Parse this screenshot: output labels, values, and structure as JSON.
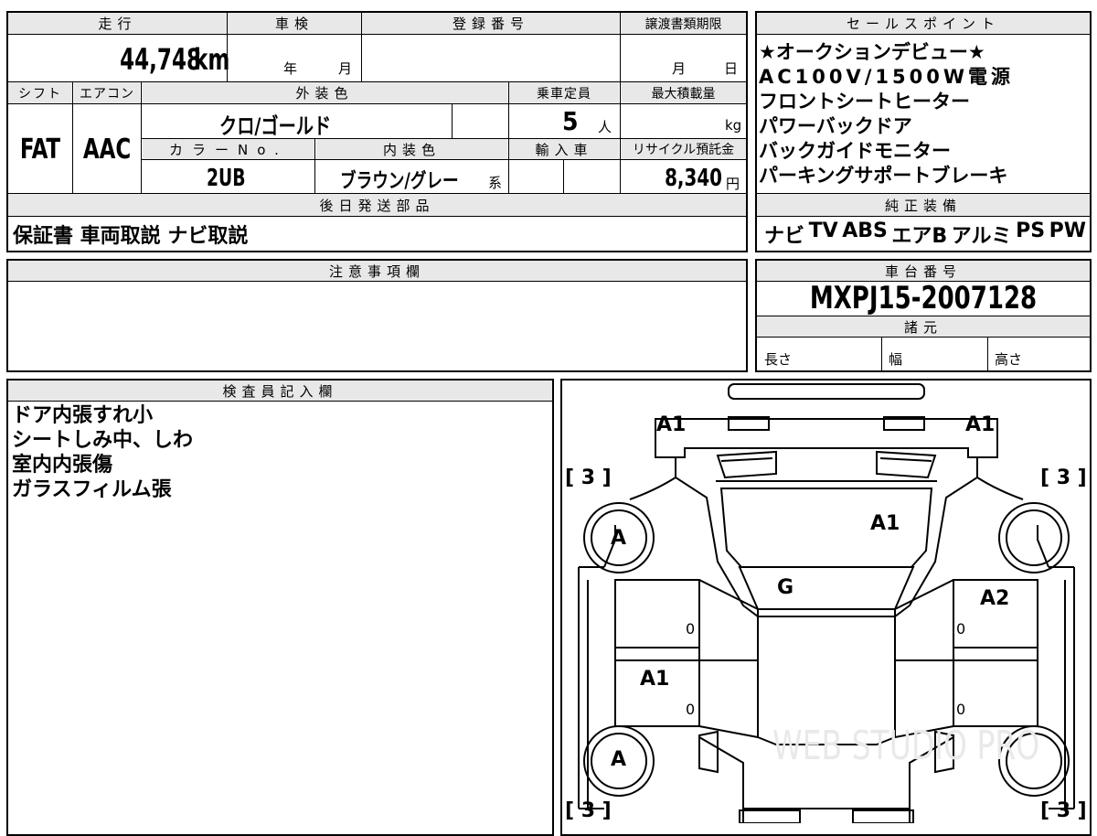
{
  "header": {
    "mileage_label": "走行",
    "inspection_label": "車検",
    "registration_label": "登録番号",
    "transfer_deadline_label": "譲渡書類期限",
    "sales_points_label": "セールスポイント",
    "shift_label": "シフト",
    "aircon_label": "エアコン",
    "exterior_color_label": "外装色",
    "capacity_label": "乗車定員",
    "max_load_label": "最大積載量",
    "color_no_label": "カラーNo.",
    "interior_color_label": "内装色",
    "import_label": "輸入車",
    "recycle_label": "リサイクル預託金",
    "later_parts_label": "後日発送部品",
    "genuine_equipment_label": "純正装備",
    "notes_label": "注意事項欄",
    "chassis_label": "車台番号",
    "specs_label": "諸元",
    "inspector_label": "検査員記入欄"
  },
  "vehicle": {
    "mileage": "44,748",
    "mileage_unit": "km",
    "inspection_year_unit": "年",
    "inspection_month_unit": "月",
    "transfer_month_unit": "月",
    "transfer_day_unit": "日",
    "shift": "FAT",
    "aircon": "AAC",
    "exterior_color": "クロ/ゴールド",
    "capacity": "5",
    "capacity_unit": "人",
    "max_load_unit": "kg",
    "color_no": "2UB",
    "interior_color": "ブラウン/グレー",
    "interior_color_suffix": "系",
    "recycle_fee": "8,340",
    "recycle_unit": "円",
    "chassis_number": "MXPJ15-2007128",
    "spec_length_label": "長さ",
    "spec_width_label": "幅",
    "spec_height_label": "高さ"
  },
  "sales_points": [
    "★オークションデビュー★",
    "AC100V/1500W電源",
    "フロントシートヒーター",
    "パワーバックドア",
    "バックガイドモニター",
    "パーキングサポートブレーキ"
  ],
  "later_parts": "保証書 車両取説 ナビ取説",
  "genuine_equipment": [
    "ナビ",
    "TV",
    "ABS",
    "エアB",
    "アルミ",
    "PS",
    "PW"
  ],
  "inspector_notes": [
    "ドア内張すれ小",
    "シートしみ中、しわ",
    "室内内張傷",
    "ガラスフィルム張"
  ],
  "diagram": {
    "marks": {
      "rear_left": "A1",
      "rear_right": "A1",
      "tire_fl": "[ 3 ]",
      "tire_fr": "[ 3 ]",
      "tire_rl": "[ 3 ]",
      "tire_rr": "[ 3 ]",
      "wheel_front_left": "A",
      "wheel_rear_left": "A",
      "roof": "A1",
      "glass": "G",
      "door_right_front": "A2",
      "door_left_rear": "A1",
      "zero": "0"
    },
    "watermark": "WEB STUDIO PRO"
  }
}
